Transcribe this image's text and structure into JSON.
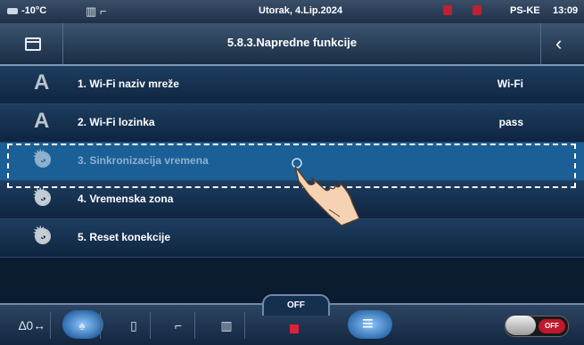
{
  "status_bar": {
    "temperature": "-10°C",
    "date": "Utorak, 4.Lip.2024",
    "user": "PS-KE",
    "time": "13:09"
  },
  "header": {
    "title": "5.8.3.Napredne funkcije"
  },
  "menu": {
    "items": [
      {
        "label": "1.  Wi-Fi naziv mreže",
        "value": "Wi-Fi",
        "icon": "letter-a-icon"
      },
      {
        "label": "2.  Wi-Fi lozinka",
        "value": "pass",
        "icon": "letter-a-icon"
      },
      {
        "label": "3.  Sinkronizacija vremena",
        "value": "",
        "icon": "gear-icon"
      },
      {
        "label": "4.  Vremenska zona",
        "value": "",
        "icon": "gear-icon"
      },
      {
        "label": "5.  Reset konekcije",
        "value": "",
        "icon": "gear-icon"
      }
    ],
    "icon_letter": "A"
  },
  "bottom_bar": {
    "off_label": "OFF",
    "toggle_label": "OFF"
  },
  "colors": {
    "accent_selected_row": "#1a5f96",
    "stop_indicator": "#e0203a",
    "toggle_off": "#c0182c"
  }
}
